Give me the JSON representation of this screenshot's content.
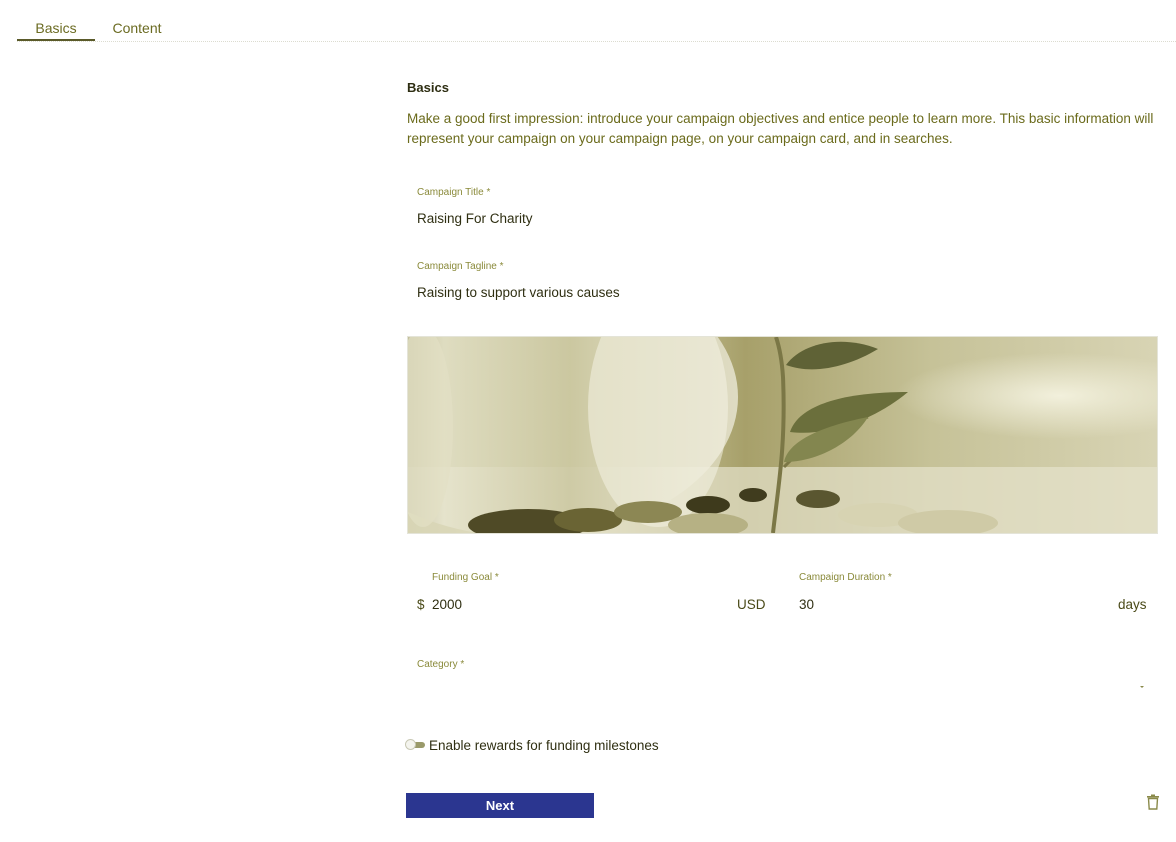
{
  "tabs": {
    "basics": "Basics",
    "content": "Content"
  },
  "form": {
    "section_title": "Basics",
    "intro": "Make a good first impression: introduce your campaign objectives and entice people to learn more. This basic information will represent your campaign on your campaign page, on your campaign card, and in searches.",
    "title": {
      "label": "Campaign Title *",
      "value": "Raising For Charity"
    },
    "tagline": {
      "label": "Campaign Tagline *",
      "value": "Raising to support various causes"
    },
    "funding_goal": {
      "label": "Funding Goal *",
      "prefix": "$",
      "value": "2000",
      "suffix": "USD"
    },
    "duration": {
      "label": "Campaign Duration *",
      "value": "30",
      "suffix": "days"
    },
    "category": {
      "label": "Category *",
      "value": ""
    },
    "rewards_toggle": {
      "label": "Enable rewards for funding milestones",
      "enabled": false
    },
    "next_label": "Next"
  },
  "icons": {
    "dropdown": "chevron-down-icon",
    "delete": "trash-icon"
  },
  "colors": {
    "accent": "#2b3690",
    "text": "#5a5a1e"
  }
}
